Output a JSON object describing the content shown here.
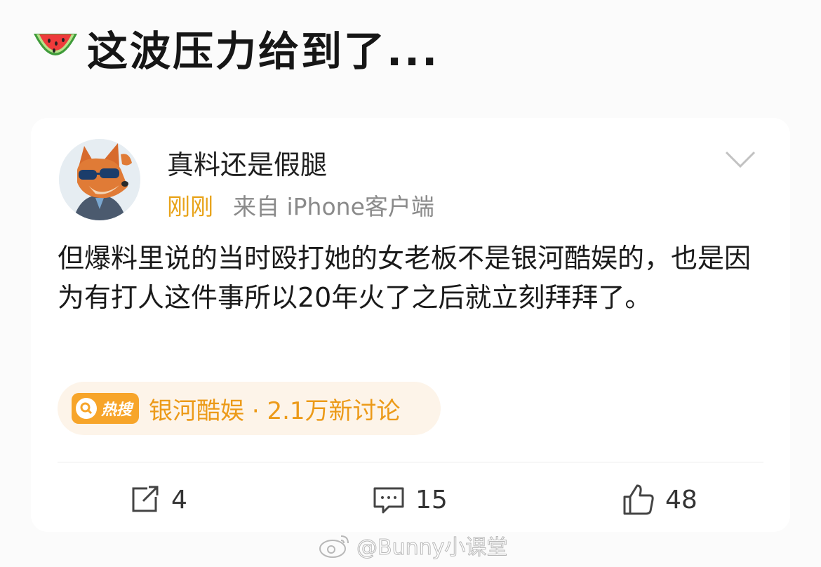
{
  "headline": {
    "icon": "watermelon-icon",
    "text": "这波压力给到了..."
  },
  "post": {
    "user": {
      "name": "真料还是假腿",
      "avatar_icon": "fox-avatar"
    },
    "time": "刚刚",
    "source": "来自 iPhone客户端",
    "content": "但爆料里说的当时殴打她的女老板不是银河酷娱的，也是因为有打人这件事所以20年火了之后就立刻拜拜了。",
    "hot_search": {
      "badge": "热搜",
      "text": "银河酷娱 · 2.1万新讨论"
    },
    "actions": {
      "repost": "4",
      "comment": "15",
      "like": "48"
    }
  },
  "watermark": "@Bunny小课堂",
  "colors": {
    "accent": "#e8a319",
    "hot_bg": "#fdf4e9",
    "hot_text": "#ec9a18"
  }
}
